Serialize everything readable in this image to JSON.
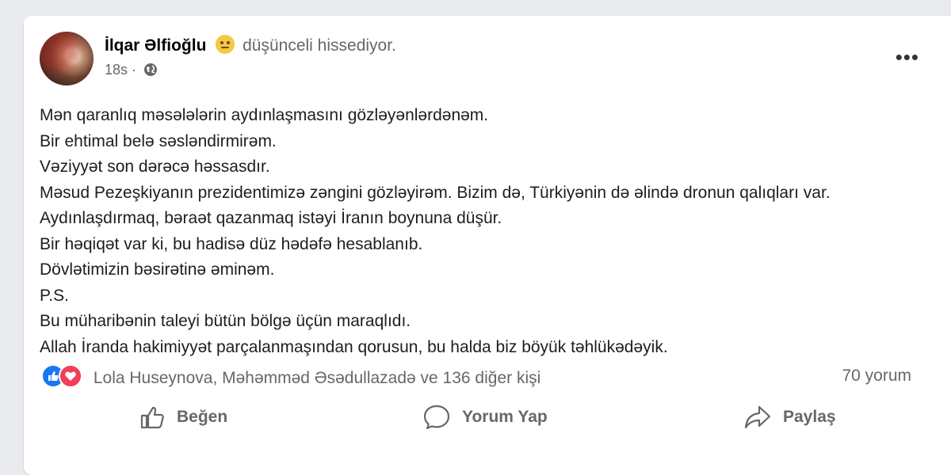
{
  "post": {
    "author": "İlqar Əlfioğlu",
    "feeling": "düşünceli hissediyor.",
    "time": "18s",
    "privacy_icon": "globe-icon",
    "more_label": "•••",
    "lines": [
      "Mən qaranlıq məsələlərin aydınlaşmasını gözləyənlərdənəm.",
      "Bir ehtimal belə səsləndirmirəm.",
      "Vəziyyət son dərəcə həssasdır.",
      "Məsud Pezeşkiyanın prezidentimizə zəngini gözləyirəm. Bizim də, Türkiyənin də əlində dronun qalıqları var.",
      "Aydınlaşdırmaq, bəraət qazanmaq istəyi İranın boynuna düşür.",
      "Bir həqiqət var ki, bu hadisə düz hədəfə hesablanıb.",
      "Dövlətimizin bəsirətinə əminəm.",
      "P.S.",
      "Bu müharibənin taleyi bütün bölgə üçün maraqlıdı.",
      "Allah İranda hakimiyyət parçalanmaşından qorusun, bu halda biz böyük təhlükədəyik."
    ]
  },
  "reactions": {
    "names": "Lola Huseynova, Məhəmməd Əsədullazadə ve 136 diğer kişi",
    "comments": "70 yorum"
  },
  "actions": {
    "like": "Beğen",
    "comment": "Yorum Yap",
    "share": "Paylaş"
  },
  "colors": {
    "like_blue": "#1877f2",
    "love_red": "#f33e58",
    "secondary_text": "#65676b"
  }
}
